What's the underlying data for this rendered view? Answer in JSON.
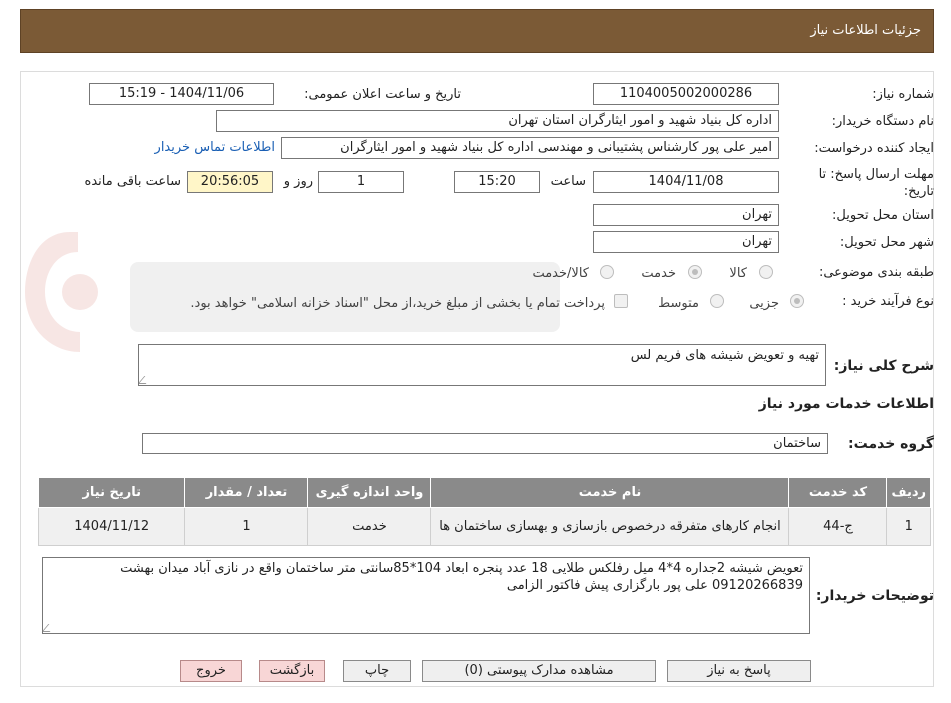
{
  "header": {
    "title": "جزئیات اطلاعات نیاز"
  },
  "form": {
    "need_number_label": "شماره نیاز:",
    "need_number_value": "1104005002000286",
    "announce_label": "تاریخ و ساعت اعلان عمومی:",
    "announce_value": "1404/11/06 - 15:19",
    "buyer_org_label": "نام دستگاه خریدار:",
    "buyer_org_value": "اداره کل بنیاد شهید و امور ایثارگران استان تهران",
    "requester_label": "ایجاد کننده درخواست:",
    "requester_value": "امیر علی پور کارشناس پشتیبانی و مهندسی اداره کل بنیاد شهید و امور ایثارگران",
    "contact_link": "اطلاعات تماس خریدار",
    "deadline_label_1": "مهلت ارسال پاسخ: تا",
    "deadline_label_2": "تاریخ:",
    "deadline_date": "1404/11/08",
    "hour_label": "ساعت",
    "deadline_time": "15:20",
    "days_value": "1",
    "days_label": "روز و",
    "remaining_time": "20:56:05",
    "remaining_label": "ساعت باقی مانده",
    "province_label": "استان محل تحویل:",
    "province_value": "تهران",
    "city_label": "شهر محل تحویل:",
    "city_value": "تهران",
    "category_label": "طبقه بندی موضوعی:",
    "category_options": [
      "کالا",
      "خدمت",
      "کالا/خدمت"
    ],
    "purchase_type_label": "نوع فرآیند خرید :",
    "purchase_type_options": [
      "جزیی",
      "متوسط"
    ],
    "payment_note": "پرداخت تمام یا بخشی از مبلغ خرید،از محل \"اسناد خزانه اسلامی\" خواهد بود.",
    "summary_label": "شرح کلی نیاز:",
    "summary_value": "تهیه و تعویض شیشه های فریم لس",
    "services_heading": "اطلاعات خدمات مورد نیاز",
    "service_group_label": "گروه خدمت:",
    "service_group_value": "ساختمان"
  },
  "table": {
    "headers": [
      "ردیف",
      "کد خدمت",
      "نام خدمت",
      "واحد اندازه گیری",
      "تعداد / مقدار",
      "تاریخ نیاز"
    ],
    "rows": [
      [
        "1",
        "ج-44",
        "انجام کارهای متفرقه درخصوص بازسازی و بهسازی ساختمان ها",
        "خدمت",
        "1",
        "1404/11/12"
      ]
    ]
  },
  "notes": {
    "label": "توضیحات خریدار:",
    "value": "تعویض شیشه 2جداره 4*4 میل رفلکس طلایی 18 عدد پنجره ابعاد 104*85سانتی متر ساختمان واقع در نازی آباد میدان بهشت 09120266839 علی پور بارگزاری پیش فاکتور الزامی"
  },
  "buttons": {
    "reply": "پاسخ به نیاز",
    "attachments": "مشاهده مدارک پیوستی (0)",
    "print": "چاپ",
    "back": "بازگشت",
    "exit": "خروج"
  }
}
